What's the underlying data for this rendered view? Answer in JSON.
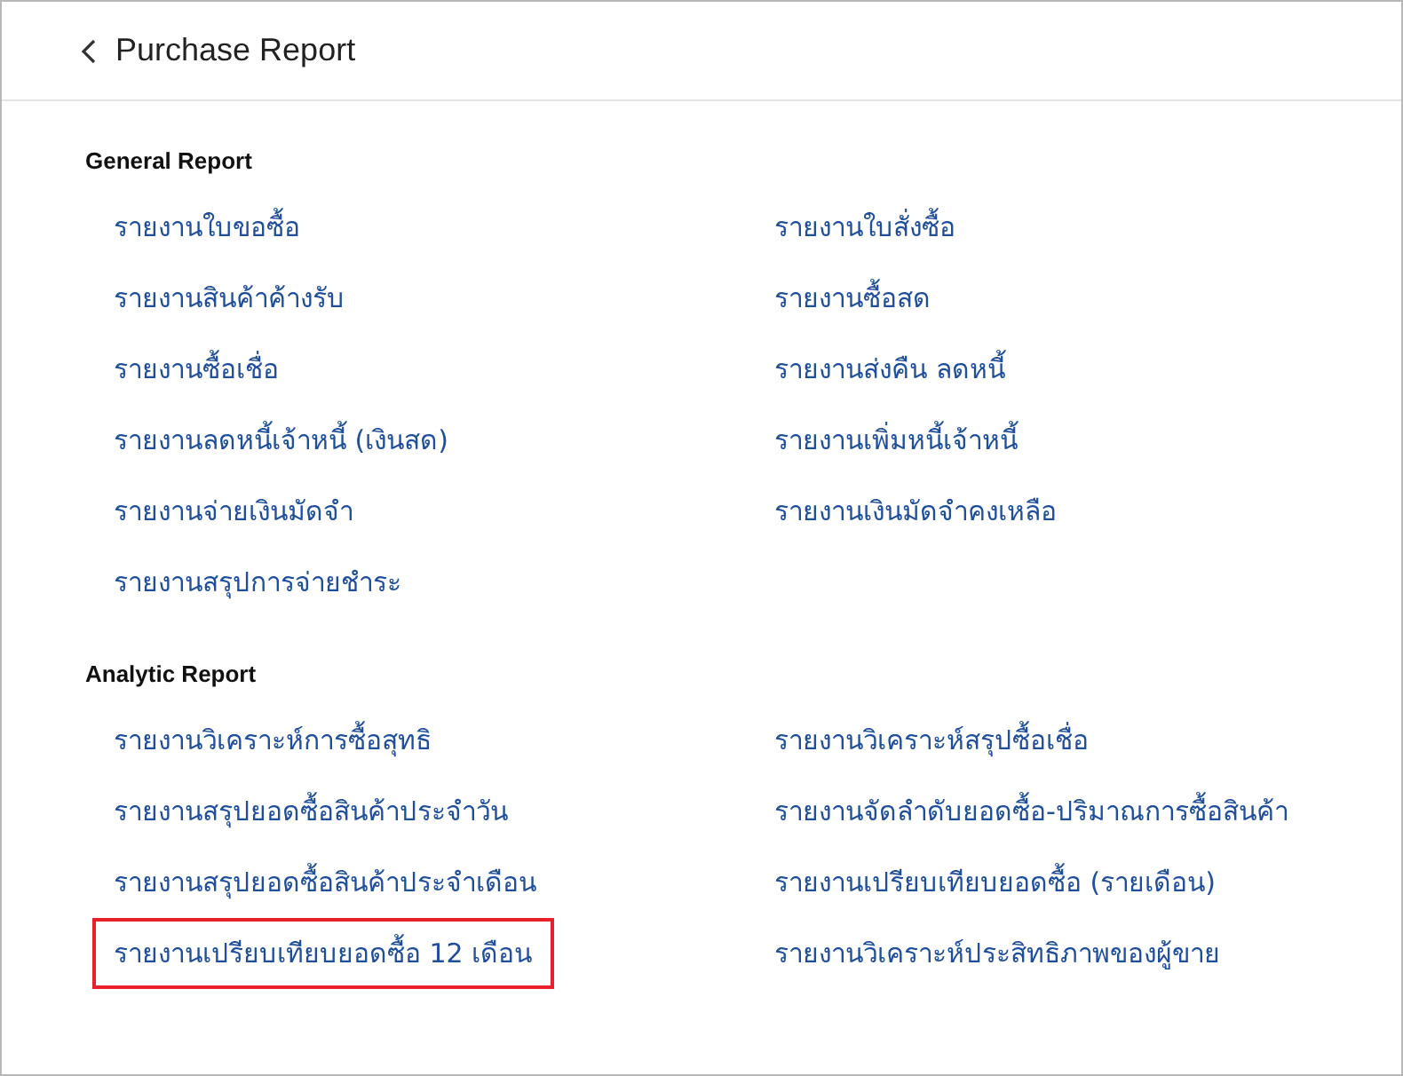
{
  "header": {
    "title": "Purchase Report"
  },
  "sections": [
    {
      "title": "General Report",
      "items": [
        {
          "label": "รายงานใบขอซื้อ",
          "highlighted": false
        },
        {
          "label": "รายงานใบสั่งซื้อ",
          "highlighted": false
        },
        {
          "label": "รายงานสินค้าค้างรับ",
          "highlighted": false
        },
        {
          "label": "รายงานซื้อสด",
          "highlighted": false
        },
        {
          "label": "รายงานซื้อเชื่อ",
          "highlighted": false
        },
        {
          "label": "รายงานส่งคืน ลดหนี้",
          "highlighted": false
        },
        {
          "label": "รายงานลดหนี้เจ้าหนี้ (เงินสด)",
          "highlighted": false
        },
        {
          "label": "รายงานเพิ่มหนี้เจ้าหนี้",
          "highlighted": false
        },
        {
          "label": "รายงานจ่ายเงินมัดจำ",
          "highlighted": false
        },
        {
          "label": "รายงานเงินมัดจำคงเหลือ",
          "highlighted": false
        },
        {
          "label": "รายงานสรุปการจ่ายชำระ",
          "highlighted": false
        }
      ]
    },
    {
      "title": "Analytic Report",
      "items": [
        {
          "label": "รายงานวิเคราะห์การซื้อสุทธิ",
          "highlighted": false
        },
        {
          "label": "รายงานวิเคราะห์สรุปซื้อเชื่อ",
          "highlighted": false
        },
        {
          "label": "รายงานสรุปยอดซื้อสินค้าประจำวัน",
          "highlighted": false
        },
        {
          "label": "รายงานจัดลำดับยอดซื้อ-ปริมาณการซื้อสินค้า",
          "highlighted": false
        },
        {
          "label": "รายงานสรุปยอดซื้อสินค้าประจำเดือน",
          "highlighted": false
        },
        {
          "label": "รายงานเปรียบเทียบยอดซื้อ (รายเดือน)",
          "highlighted": false
        },
        {
          "label": "รายงานเปรียบเทียบยอดซื้อ 12 เดือน",
          "highlighted": true
        },
        {
          "label": "รายงานวิเคราะห์ประสิทธิภาพของผู้ขาย",
          "highlighted": false
        }
      ]
    }
  ]
}
